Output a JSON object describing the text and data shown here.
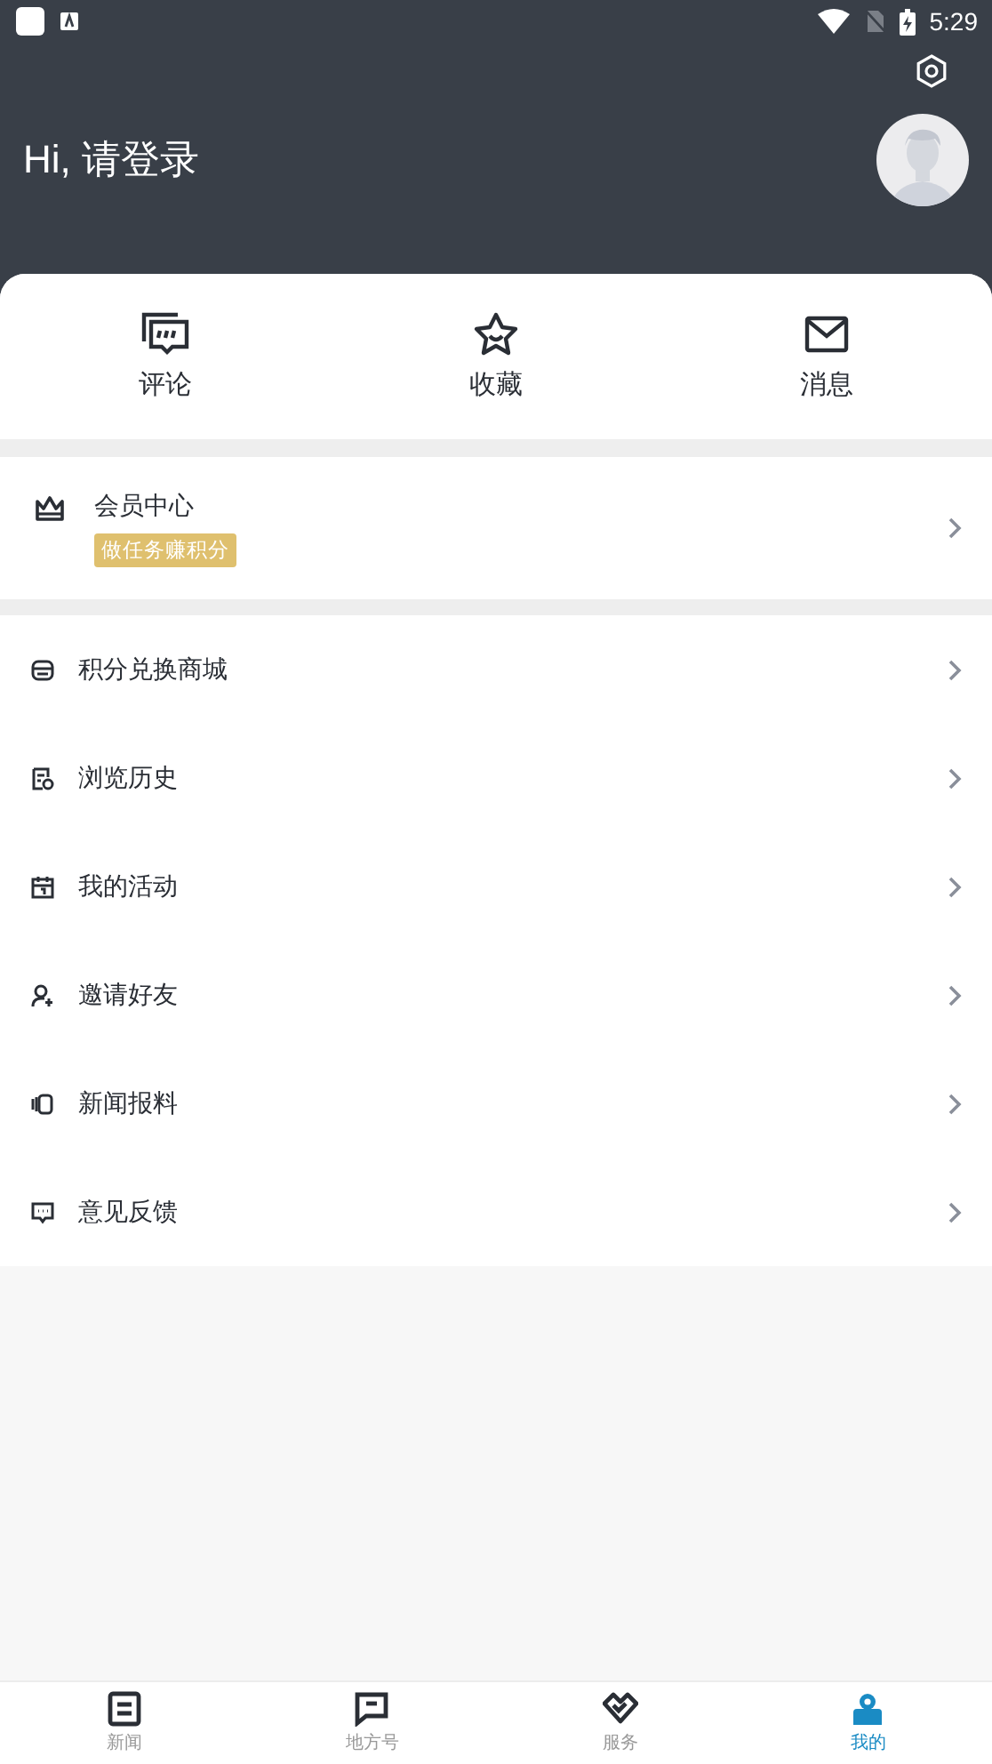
{
  "status_bar": {
    "time": "5:29"
  },
  "header": {
    "greeting": "Hi, 请登录"
  },
  "quick_actions": [
    {
      "label": "评论"
    },
    {
      "label": "收藏"
    },
    {
      "label": "消息"
    }
  ],
  "member": {
    "title": "会员中心",
    "badge": "做任务赚积分"
  },
  "menu": [
    {
      "label": "积分兑换商城"
    },
    {
      "label": "浏览历史"
    },
    {
      "label": "我的活动"
    },
    {
      "label": "邀请好友"
    },
    {
      "label": "新闻报料"
    },
    {
      "label": "意见反馈"
    }
  ],
  "tabs": [
    {
      "label": "新闻",
      "selected": false
    },
    {
      "label": "地方号",
      "selected": false
    },
    {
      "label": "服务",
      "selected": false
    },
    {
      "label": "我的",
      "selected": true
    }
  ]
}
